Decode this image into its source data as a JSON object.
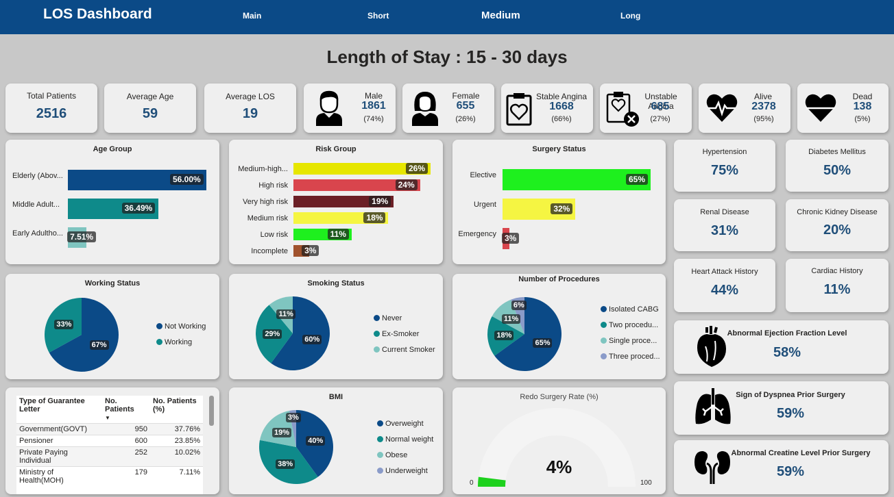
{
  "nav": {
    "brand": "LOS Dashboard",
    "tabs": [
      "Main",
      "Short",
      "Medium",
      "Long"
    ],
    "active": "Medium"
  },
  "title": "Length of Stay : 15 - 30 days",
  "kpis": {
    "total_patients": {
      "label": "Total Patients",
      "value": "2516"
    },
    "average_age": {
      "label": "Average Age",
      "value": "59"
    },
    "average_los": {
      "label": "Average LOS",
      "value": "19"
    },
    "male": {
      "label": "Male",
      "value": "1861",
      "pct": "(74%)"
    },
    "female": {
      "label": "Female",
      "value": "655",
      "pct": "(26%)"
    },
    "stable_angina": {
      "label": "Stable Angina",
      "value": "1668",
      "pct": "(66%)"
    },
    "unstable_angina": {
      "label": "Unstable Angina",
      "value": "685",
      "pct": "(27%)"
    },
    "alive": {
      "label": "Alive",
      "value": "2378",
      "pct": "(95%)"
    },
    "dead": {
      "label": "Dead",
      "value": "138",
      "pct": "(5%)"
    }
  },
  "conditions": {
    "hypertension": {
      "label": "Hypertension",
      "value": "75%"
    },
    "diabetes": {
      "label": "Diabetes Mellitus",
      "value": "50%"
    },
    "renal": {
      "label": "Renal Disease",
      "value": "31%"
    },
    "ckd": {
      "label": "Chronic Kidney Disease",
      "value": "20%"
    },
    "heart_attack": {
      "label": "Heart Attack History",
      "value": "44%"
    },
    "cardiac": {
      "label": "Cardiac History",
      "value": "11%"
    },
    "ejection": {
      "label": "Abnormal Ejection Fraction Level",
      "value": "58%"
    },
    "dyspnea": {
      "label": "Sign of Dyspnea Prior Surgery",
      "value": "59%"
    },
    "creatine": {
      "label": "Abnormal Creatine Level Prior Surgery",
      "value": "59%"
    }
  },
  "colors": {
    "navy": "#0b4a87",
    "teal": "#0e8a8a",
    "lightteal": "#7fc5c0",
    "lavender": "#8a9bc9",
    "yellow": "#e6e600",
    "red": "#d9454d",
    "maroon": "#6b1f26",
    "lightyellow": "#f5f542",
    "green": "#1ef01e"
  },
  "chart_data": [
    {
      "type": "bar",
      "title": "Age Group",
      "categories": [
        "Elderly (Abov...",
        "Middle Adult...",
        "Early Adultho..."
      ],
      "values": [
        56.0,
        36.49,
        7.51
      ],
      "labels": [
        "56.00%",
        "36.49%",
        "7.51%"
      ],
      "colors": [
        "#0b4a87",
        "#0e8a8a",
        "#7fc5c0"
      ]
    },
    {
      "type": "bar",
      "title": "Risk Group",
      "categories": [
        "Medium-high...",
        "High risk",
        "Very high risk",
        "Medium risk",
        "Low risk",
        "Incomplete"
      ],
      "values": [
        26,
        24,
        19,
        18,
        11,
        3
      ],
      "labels": [
        "26%",
        "24%",
        "19%",
        "18%",
        "11%",
        "3%"
      ],
      "colors": [
        "#e6e600",
        "#d9454d",
        "#6b1f26",
        "#f5f542",
        "#1ef01e",
        "#a0522d"
      ]
    },
    {
      "type": "bar",
      "title": "Surgery Status",
      "categories": [
        "Elective",
        "Urgent",
        "Emergency"
      ],
      "values": [
        65,
        32,
        3
      ],
      "labels": [
        "65%",
        "32%",
        "3%"
      ],
      "colors": [
        "#1ef01e",
        "#f5f542",
        "#d9454d"
      ]
    },
    {
      "type": "pie",
      "title": "Working Status",
      "series": [
        {
          "name": "Not Working",
          "value": 67
        },
        {
          "name": "Working",
          "value": 33
        }
      ],
      "colors": [
        "#0b4a87",
        "#0e8a8a"
      ]
    },
    {
      "type": "pie",
      "title": "Smoking Status",
      "series": [
        {
          "name": "Never",
          "value": 60
        },
        {
          "name": "Ex-Smoker",
          "value": 29
        },
        {
          "name": "Current Smoker",
          "value": 11
        }
      ],
      "colors": [
        "#0b4a87",
        "#0e8a8a",
        "#7fc5c0"
      ]
    },
    {
      "type": "pie",
      "title": "Number of Procedures",
      "series": [
        {
          "name": "Isolated CABG",
          "value": 65
        },
        {
          "name": "Two procedu...",
          "value": 18
        },
        {
          "name": "Single proce...",
          "value": 11
        },
        {
          "name": "Three proced...",
          "value": 6
        }
      ],
      "colors": [
        "#0b4a87",
        "#0e8a8a",
        "#7fc5c0",
        "#8a9bc9"
      ]
    },
    {
      "type": "pie",
      "title": "BMI",
      "series": [
        {
          "name": "Overweight",
          "value": 40
        },
        {
          "name": "Normal weight",
          "value": 38
        },
        {
          "name": "Obese",
          "value": 19
        },
        {
          "name": "Underweight",
          "value": 3
        }
      ],
      "colors": [
        "#0b4a87",
        "#0e8a8a",
        "#7fc5c0",
        "#8a9bc9"
      ]
    },
    {
      "type": "gauge",
      "title": "Redo Surgery Rate (%)",
      "value": 4,
      "label": "4%",
      "min": 0,
      "max": 100,
      "min_label": "0",
      "max_label": "100"
    },
    {
      "type": "table",
      "columns": [
        "Type of Guarantee Letter",
        "No. Patients",
        "No. Patients (%)"
      ],
      "rows": [
        [
          "Government(GOVT)",
          "950",
          "37.76%"
        ],
        [
          "Pensioner",
          "600",
          "23.85%"
        ],
        [
          "Private Paying Individual",
          "252",
          "10.02%"
        ],
        [
          "Ministry of Health(MOH)",
          "179",
          "7.11%"
        ]
      ]
    }
  ]
}
